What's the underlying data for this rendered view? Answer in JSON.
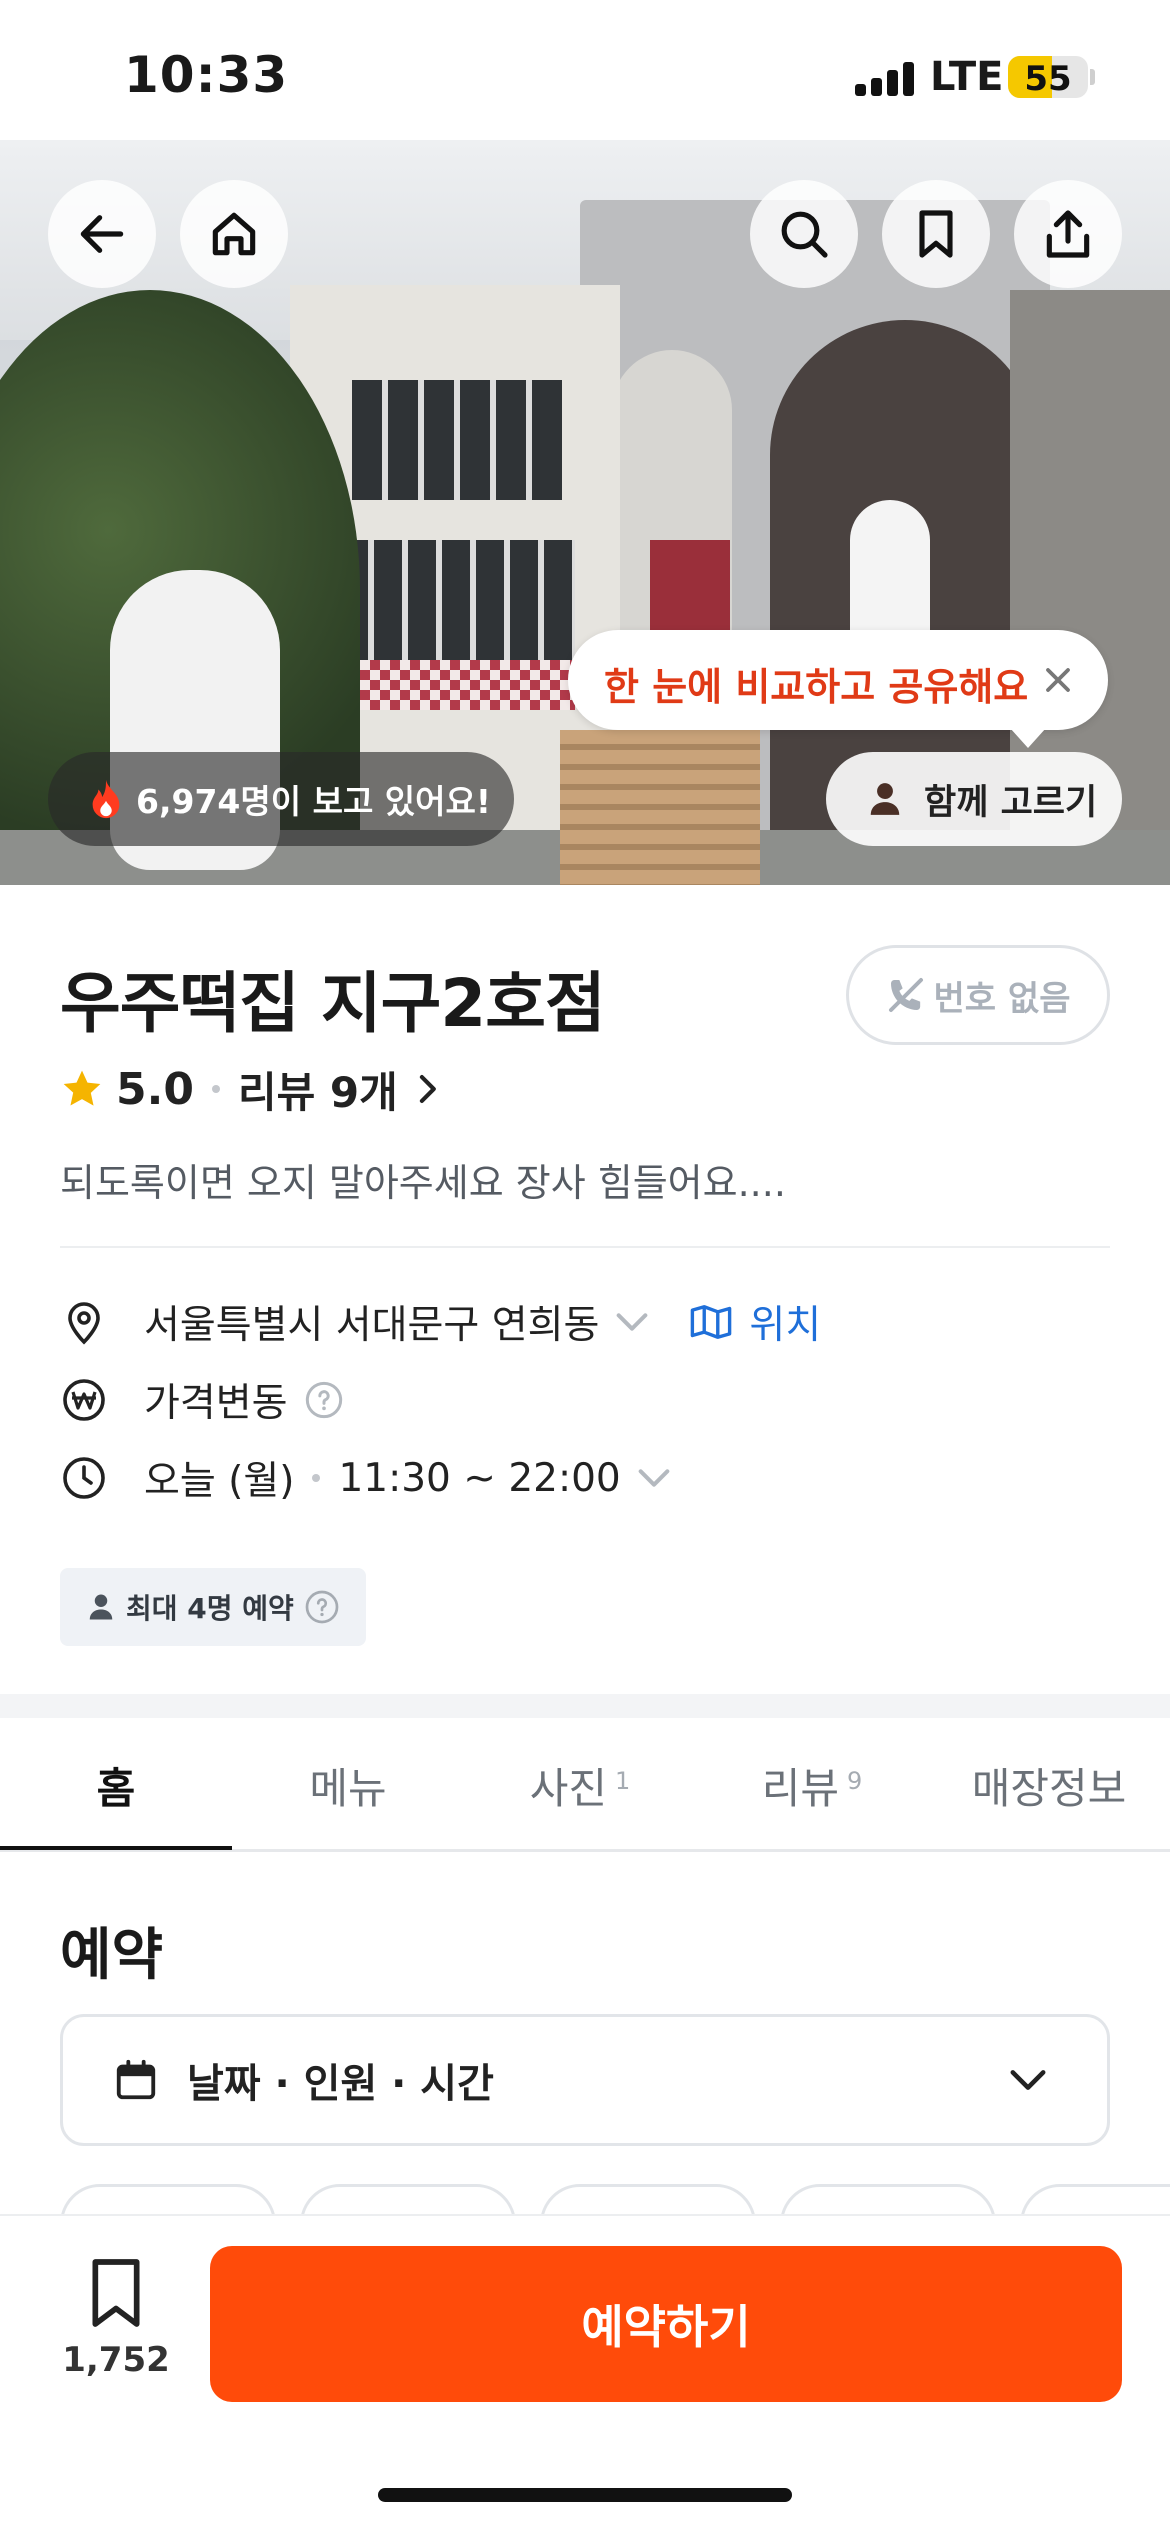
{
  "status_bar": {
    "time": "10:33",
    "network": "LTE",
    "battery": "55",
    "battery_level": 0.55
  },
  "hero": {
    "icons": {
      "back": "arrow-left-icon",
      "home": "home-icon",
      "search": "search-icon",
      "bookmark": "bookmark-icon",
      "share": "share-icon"
    },
    "tooltip": "한 눈에 비교하고 공유해요",
    "viewers": "6,974명이 보고 있어요!",
    "pick_together": "함께 고르기"
  },
  "store": {
    "name": "우주떡집 지구2호점",
    "no_phone": "번호 없음",
    "rating": "5.0",
    "reviews": "리뷰 9개",
    "description": "되도록이면 오지 말아주세요 장사 힘들어요...."
  },
  "info": {
    "address": "서울특별시 서대문구 연희동",
    "map_link": "위치",
    "price_change": "가격변동",
    "hours_day": "오늘 (월)",
    "hours_time": "11:30 ~ 22:00",
    "max_reservation": "최대 4명 예약"
  },
  "tabs": [
    {
      "label": "홈",
      "count": ""
    },
    {
      "label": "메뉴",
      "count": ""
    },
    {
      "label": "사진",
      "count": "1"
    },
    {
      "label": "리뷰",
      "count": "9"
    },
    {
      "label": "매장정보",
      "count": ""
    }
  ],
  "reservation": {
    "title": "예약",
    "selector_label": "날짜 · 인원 · 시간"
  },
  "bottom": {
    "save_count": "1,752",
    "reserve_button": "예약하기"
  },
  "colors": {
    "accent": "#ff4b0a",
    "tooltip_text": "#e03a16",
    "map_link": "#1f6fd9",
    "star": "#f5b400"
  }
}
